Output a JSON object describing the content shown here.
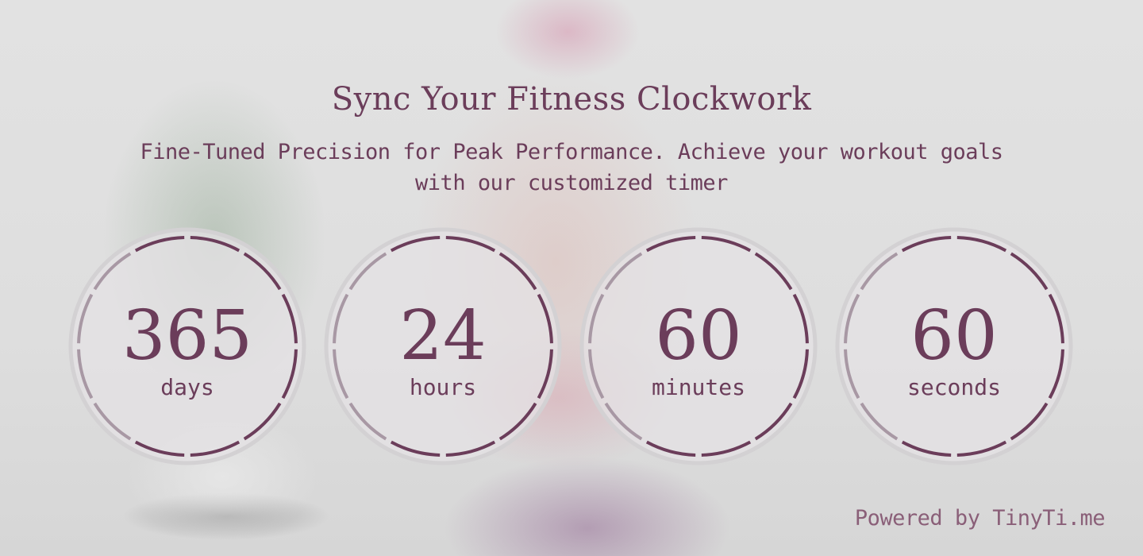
{
  "header": {
    "title": "Sync Your Fitness Clockwork",
    "subtitle": "Fine-Tuned Precision for Peak Performance. Achieve your workout goals with our customized timer"
  },
  "timers": [
    {
      "value": "365",
      "unit": "days"
    },
    {
      "value": "24",
      "unit": "hours"
    },
    {
      "value": "60",
      "unit": "minutes"
    },
    {
      "value": "60",
      "unit": "seconds"
    }
  ],
  "footer": {
    "powered_by": "Powered by TinyTi.me"
  },
  "colors": {
    "accent": "#6b3d5a",
    "ring_muted": "#a898a4",
    "dial_fill": "#e4e2e4",
    "dial_border": "#d3d1d3"
  }
}
